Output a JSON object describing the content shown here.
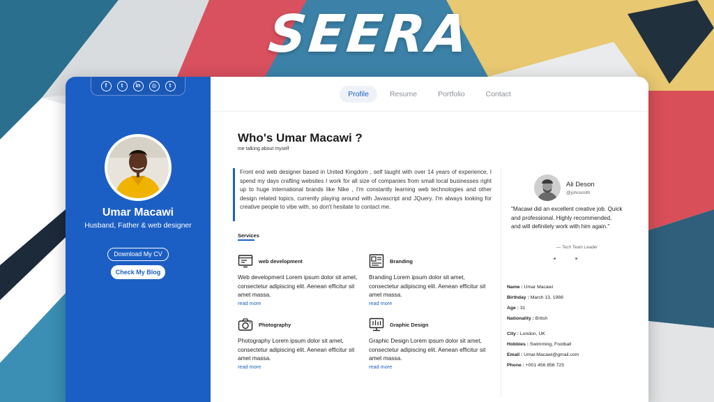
{
  "brand": "SEERA",
  "social": [
    {
      "icon": "facebook-icon",
      "glyph": "f"
    },
    {
      "icon": "twitter-icon",
      "glyph": "t"
    },
    {
      "icon": "linkedin-icon",
      "glyph": "in"
    },
    {
      "icon": "instagram-icon",
      "glyph": "◎"
    },
    {
      "icon": "tumblr-icon",
      "glyph": "t"
    }
  ],
  "sidebar": {
    "name": "Umar Macawi",
    "role": "Husband, Father & web designer",
    "download_label": "Download My CV",
    "blog_label": "Check My Blog"
  },
  "nav": {
    "items": [
      "Profile",
      "Resume",
      "Portfolio",
      "Contact"
    ],
    "active": "Profile"
  },
  "profile": {
    "title": "Who's Umar Macawi ?",
    "subtitle": "me talking about myself",
    "about": "Front end web designer based in United Kingdom , self taught with over 14 years of experience, I spend my days crafting websites I work for all size of companies from small local businesses right up to huge international brands like Nike , I'm constantly learning web technologies and other design related topics, currently playing around with Javascript and JQuery. I'm always looking for creative people to vibe with, so don't hesitate to contact me."
  },
  "services": {
    "heading": "Services",
    "items": [
      {
        "icon": "web-development-icon",
        "title": "web development",
        "text": "Web development Lorem ipsum dolor sit amet, consectetur adipiscing elit. Aenean efficitur sit amet massa.",
        "more": "read more"
      },
      {
        "icon": "branding-icon",
        "title": "Branding",
        "text": "Branding Lorem ipsum dolor sit amet, consectetur adipiscing elit. Aenean efficitur sit amet massa.",
        "more": "read more"
      },
      {
        "icon": "camera-icon",
        "title": "Photography",
        "text": "Photography Lorem ipsum dolor sit amet, consectetur adipiscing elit. Aenean efficitur sit amet massa.",
        "more": "read more"
      },
      {
        "icon": "graphic-design-icon",
        "title": "Graphic Design",
        "text": "Graphic Design Lorem ipsum dolor sit amet, consectetur adipiscing elit. Aenean efficitur sit amet massa.",
        "more": "read more"
      }
    ]
  },
  "testimonial": {
    "name": "Ali Deson",
    "handle": "@johnsmith",
    "quote": "\"Macawi did an excellent creative job. Quick and professional. Highly recommended, and will definitely work with him again.\"",
    "role": "— Tech Team Leader"
  },
  "info": [
    {
      "label": "Name :",
      "value": " Umar Macawi"
    },
    {
      "label": "Birthday :",
      "value": " March 13, 1988"
    },
    {
      "label": "Age :",
      "value": " 31"
    },
    {
      "label": "Nationality :",
      "value": " Britsh"
    },
    {
      "label": "City :",
      "value": " London, UK"
    },
    {
      "label": "Hobbies :",
      "value": " Swimming, Football"
    },
    {
      "label": "Email :",
      "value": " Umar.Macawi@gmail.com"
    },
    {
      "label": "Phone :",
      "value": " +001 456 856 723"
    }
  ],
  "colors": {
    "accent": "#1c5fc4",
    "sidebar": "#1c5fc4",
    "card": "#ffffff"
  }
}
